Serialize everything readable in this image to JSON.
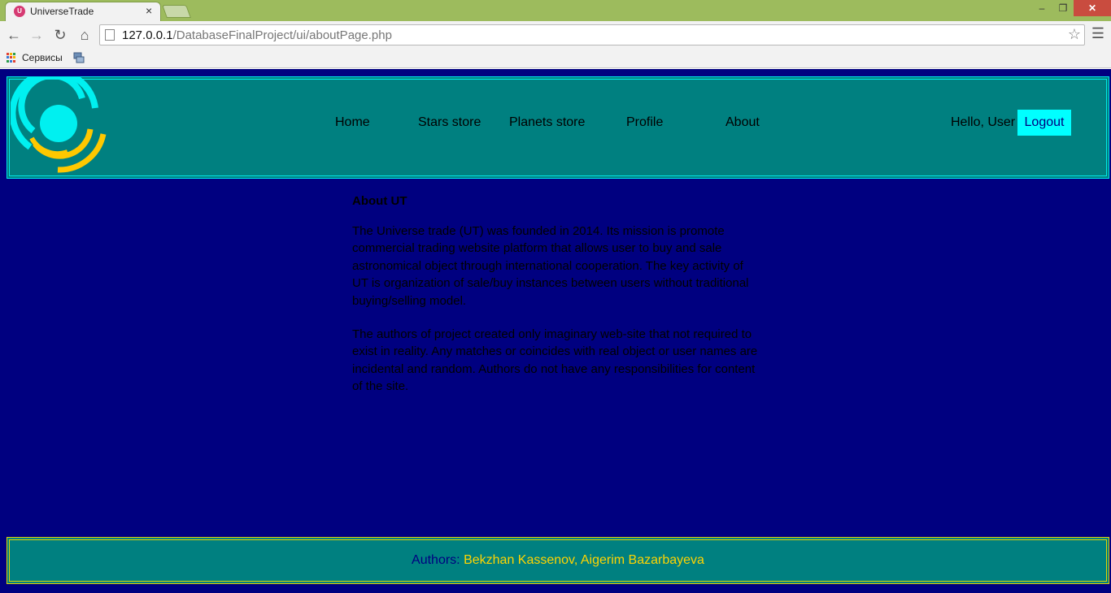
{
  "browser": {
    "tab_title": "UniverseTrade",
    "tab_close": "×",
    "url_host": "127.0.0.1",
    "url_path": "/DatabaseFinalProject/ui/aboutPage.php",
    "bookmarks": [
      "Сервисы"
    ],
    "icons": [
      "back-arrow-icon",
      "forward-arrow-icon",
      "reload-icon",
      "home-icon",
      "page-icon",
      "star-icon",
      "menu-icon",
      "apps-icon"
    ]
  },
  "header": {
    "nav": [
      "Home",
      "Stars store",
      "Planets store",
      "Profile",
      "About"
    ],
    "greeting": "Hello, User",
    "logout": "Logout"
  },
  "content": {
    "title": "About UT",
    "paragraphs": [
      "The Universe trade (UT) was founded in 2014. Its mission is promote commercial trading website platform that allows user to buy and sale astronomical object through international cooperation. The key activity of UT is organization of sale/buy instances between users without traditional buying/selling model.",
      "The authors of project created only imaginary web-site that not required to exist in reality. Any matches or coincides with real object or user names are incidental and random. Authors do not have any responsibilities for content of the site."
    ]
  },
  "footer": {
    "label": "Authors:",
    "names": "Bekzhan Kassenov, Aigerim Bazarbayeva"
  },
  "colors": {
    "page_bg": "#000080",
    "panel_bg": "#008080",
    "accent_cyan": "#00ffff",
    "accent_gold": "#ffd400"
  }
}
